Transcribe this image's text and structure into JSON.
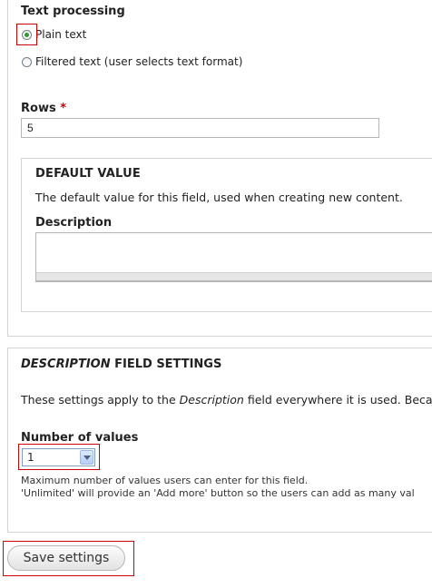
{
  "text_processing": {
    "label": "Text processing",
    "options": [
      {
        "label": "Plain text",
        "checked": true
      },
      {
        "label": "Filtered text (user selects text format)",
        "checked": false
      }
    ]
  },
  "rows": {
    "label": "Rows",
    "required_marker": "*",
    "value": "5"
  },
  "default_value": {
    "title": "DEFAULT VALUE",
    "description": "The default value for this field, used when creating new content.",
    "field_label": "Description",
    "field_value": ""
  },
  "field_settings": {
    "title_emphasis": "DESCRIPTION",
    "title_rest": " FIELD SETTINGS",
    "intro_before": "These settings apply to the ",
    "intro_emphasis": "Description",
    "intro_after": " field everywhere it is used. Beca"
  },
  "number_of_values": {
    "label": "Number of values",
    "selected": "1",
    "help_line1": "Maximum number of values users can enter for this field.",
    "help_line2": "'Unlimited' will provide an 'Add more' button so the users can add as many val"
  },
  "actions": {
    "save_label": "Save settings"
  },
  "colors": {
    "highlight": "#cc0000",
    "radio_checked": "#2f9a2f",
    "required": "#cc0000"
  }
}
